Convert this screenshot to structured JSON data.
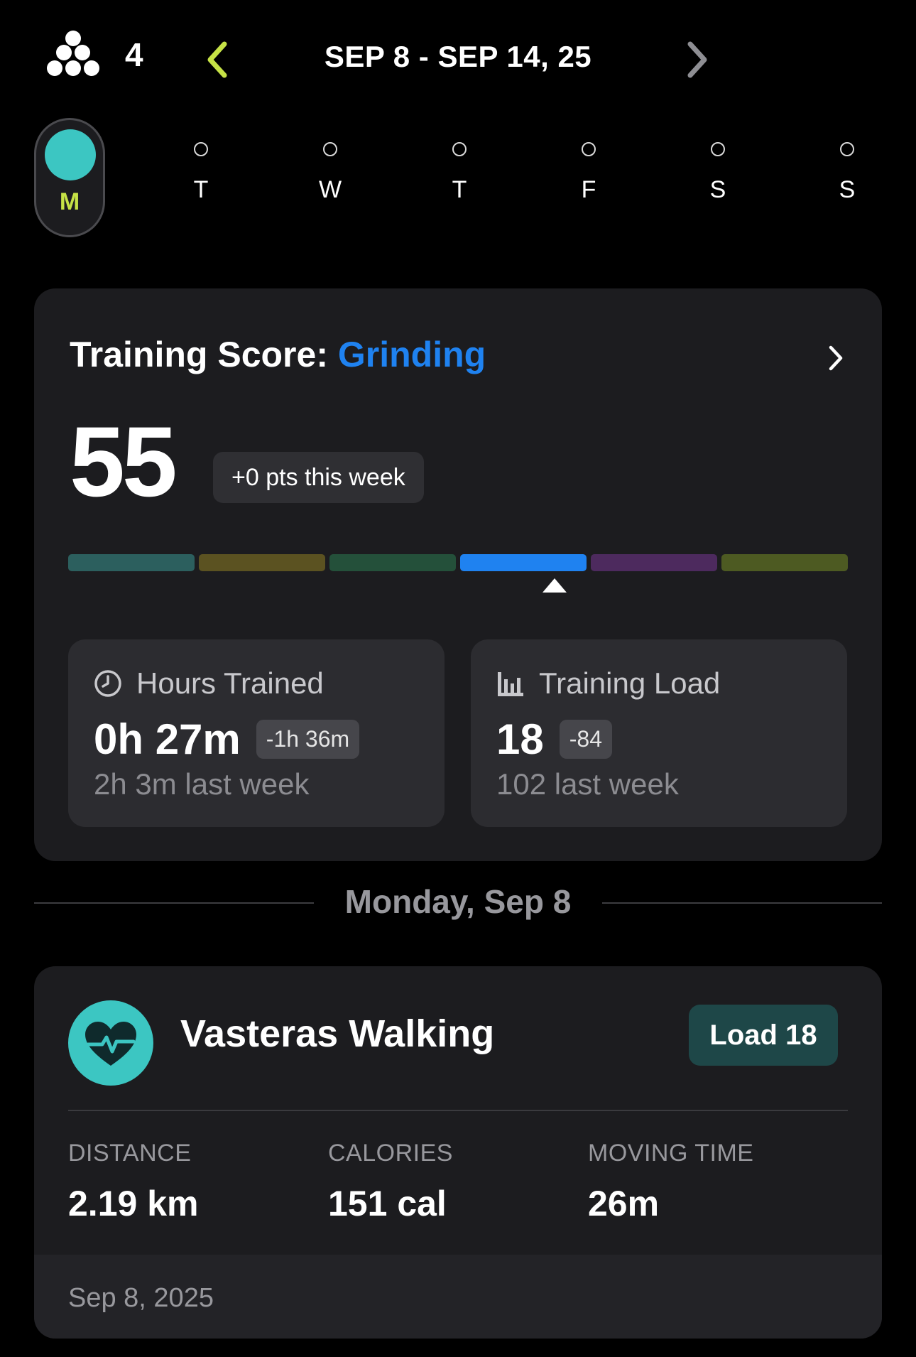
{
  "header": {
    "team_icon": "team-dots-icon",
    "team_count": "4",
    "week_range": "SEP 8 - SEP 14, 25",
    "prev_icon": "chevron-left-icon",
    "next_icon": "chevron-right-icon",
    "accent_color": "#c6e246"
  },
  "days": [
    {
      "label": "M",
      "selected": true
    },
    {
      "label": "T"
    },
    {
      "label": "W"
    },
    {
      "label": "T"
    },
    {
      "label": "F"
    },
    {
      "label": "S"
    },
    {
      "label": "S"
    }
  ],
  "training_score": {
    "title_prefix": "Training Score:",
    "status": "Grinding",
    "status_color": "#1f82f0",
    "value": "55",
    "delta": "+0 pts this week",
    "segment_colors": [
      "#2c5f5e",
      "#5b5221",
      "#24503a",
      "#1f82f0",
      "#4d2a5e",
      "#4d5a22"
    ],
    "active_segment": 3
  },
  "hours_trained": {
    "label": "Hours Trained",
    "icon": "clock-icon",
    "value": "0h 27m",
    "change": "-1h 36m",
    "last_week": "2h 3m last week"
  },
  "training_load": {
    "label": "Training Load",
    "icon": "bar-chart-icon",
    "value": "18",
    "change": "-84",
    "last_week": "102 last week"
  },
  "date_divider": "Monday, Sep 8",
  "activity": {
    "icon": "heart-pulse-icon",
    "title": "Vasteras Walking",
    "load": "Load 18",
    "metrics": [
      {
        "label": "DISTANCE",
        "value": "2.19 km"
      },
      {
        "label": "CALORIES",
        "value": "151 cal"
      },
      {
        "label": "MOVING TIME",
        "value": "26m"
      }
    ],
    "date": "Sep 8, 2025"
  }
}
